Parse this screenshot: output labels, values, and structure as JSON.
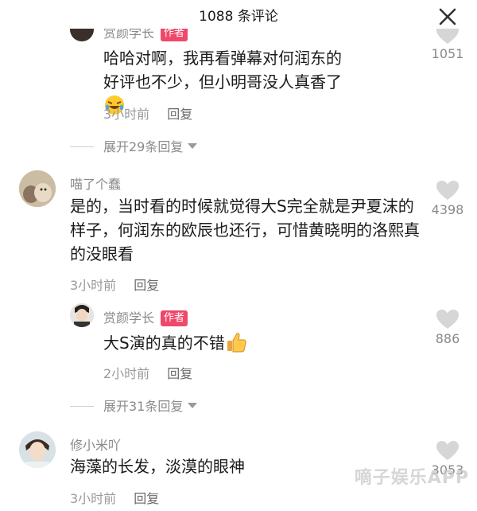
{
  "header": {
    "title": "1088 条评论"
  },
  "comments": [
    {
      "name": "赏颜学长",
      "tag": "作者",
      "text": "哈哈对啊，我再看弹幕对何润东的好评也不少，但小明哥没人真香了",
      "time": "3小时前",
      "reply": "回复",
      "likes": "1051",
      "expand": "展开29条回复"
    },
    {
      "name": "喵了个蠢",
      "text": "是的，当时看的时候就觉得大S完全就是尹夏沫的样子，何润东的欧辰也还行，可惜黄晓明的洛熙真的没眼看",
      "time": "3小时前",
      "reply": "回复",
      "likes": "4398"
    },
    {
      "name": "赏颜学长",
      "tag": "作者",
      "text": "大S演的真的不错",
      "time": "2小时前",
      "reply": "回复",
      "likes": "886",
      "expand": "展开31条回复"
    },
    {
      "name": "修小米吖",
      "text": "海藻的长发，淡漠的眼神",
      "time": "3小时前",
      "reply": "回复",
      "likes": "3053"
    }
  ],
  "watermark": "嘀子娱乐APP",
  "colors": {
    "author_tag": "#f0486a",
    "heart": "#d6d6d6"
  }
}
